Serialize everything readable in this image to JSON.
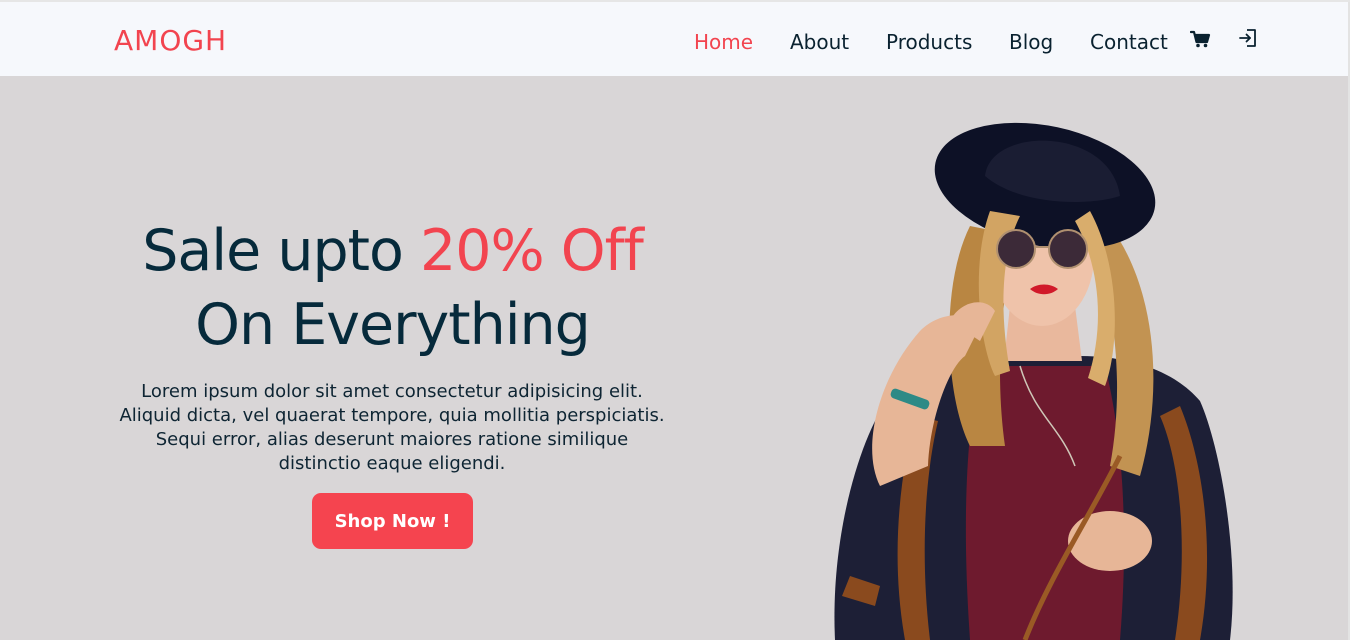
{
  "brand": {
    "name": "AMOGH",
    "accent_color": "#f2444f"
  },
  "nav": {
    "links": [
      {
        "label": "Home",
        "active": true
      },
      {
        "label": "About",
        "active": false
      },
      {
        "label": "Products",
        "active": false
      },
      {
        "label": "Blog",
        "active": false
      },
      {
        "label": "Contact",
        "active": false
      }
    ],
    "icons": [
      "cart-icon",
      "sign-in-icon"
    ]
  },
  "hero": {
    "headline_part1": "Sale upto ",
    "headline_accent": "20% Off",
    "headline_line2": "On Everything",
    "description": "Lorem ipsum dolor sit amet consectetur adipisicing elit. Aliquid dicta, vel quaerat tempore, quia mollitia perspiciatis. Sequi error, alias deserunt maiores ratione similique distinctio eaque eligendi.",
    "cta_label": "Shop Now !",
    "image": "fashion-model-with-hat-and-sunglasses"
  },
  "colors": {
    "nav_bg": "#f6f8fc",
    "hero_bg": "#d9d6d7",
    "text_dark": "#062a3b",
    "button_bg": "#f5444f"
  }
}
